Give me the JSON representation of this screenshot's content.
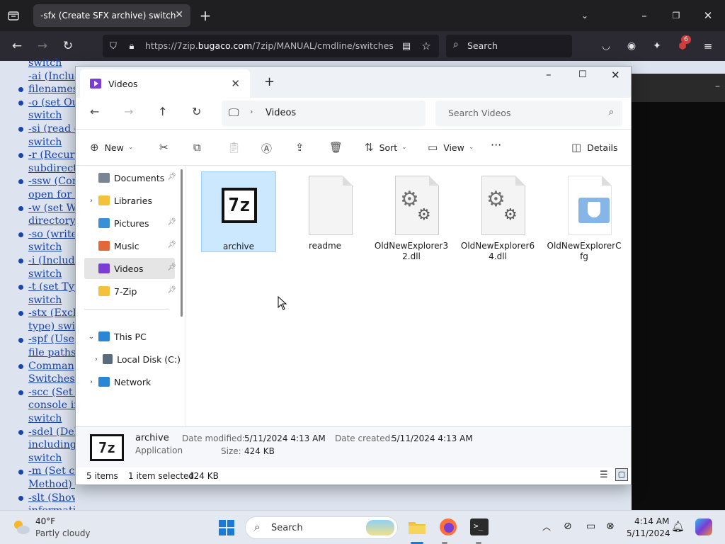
{
  "browser": {
    "tab_title": "-sfx (Create SFX archive) switch",
    "url_prefix": "https://7zip.",
    "url_domain": "bugaco.com",
    "url_path": "/7zip/MANUAL/cmdline/switches",
    "search_placeholder": "Search",
    "extension_badge": "6"
  },
  "webpage": {
    "links": [
      "switch",
      "-ai (Include",
      "filenames",
      "-o (set Ou",
      "switch",
      "-si (read d",
      "switch",
      "-r (Recurs",
      "subdirecto",
      "-ssw (Com",
      "open for w",
      "-w (set W",
      "directory)",
      "-so (write",
      "switch",
      "-i (Include",
      "switch",
      "-t (set Typ",
      "switch",
      "-stx (Excl",
      "type) swit",
      "-spf (Use",
      "file paths)",
      "Comman",
      "Switches",
      "-scc (Set c",
      "console in",
      "switch",
      "-sdel (Del",
      "including",
      "switch",
      "-m (Set co",
      "Method) s",
      "-slt (Show",
      "informati"
    ],
    "bullet_rows": [
      2,
      3,
      5,
      7,
      9,
      11,
      13,
      15,
      17,
      19,
      21,
      23,
      25,
      28,
      31,
      33
    ]
  },
  "explorer": {
    "title": "Videos",
    "breadcrumb": "Videos",
    "search_placeholder": "Search Videos",
    "commands": {
      "new": "New",
      "sort": "Sort",
      "view": "View",
      "more": "···",
      "details": "Details"
    },
    "nav_items": [
      {
        "label": "Documents",
        "icon": "documents-icon",
        "color": "#7a8594",
        "pinned": true,
        "expandable": false
      },
      {
        "label": "Libraries",
        "icon": "folder-icon",
        "color": "#f2c23a",
        "pinned": false,
        "expandable": true
      },
      {
        "label": "Pictures",
        "icon": "pictures-icon",
        "color": "#3a8fd8",
        "pinned": true,
        "expandable": false
      },
      {
        "label": "Music",
        "icon": "music-icon",
        "color": "#e2683c",
        "pinned": true,
        "expandable": false
      },
      {
        "label": "Videos",
        "icon": "videos-icon",
        "color": "#7a3ed6",
        "pinned": true,
        "expandable": false,
        "selected": true
      },
      {
        "label": "7-Zip",
        "icon": "folder-icon",
        "color": "#f2c23a",
        "pinned": true,
        "expandable": false
      }
    ],
    "tree_items": [
      {
        "label": "This PC",
        "icon": "this-pc-icon",
        "color": "#2b87d6",
        "expanded": true
      },
      {
        "label": "Local Disk (C:)",
        "icon": "local-disk-icon",
        "color": "#5a6b7d",
        "expanded": false
      },
      {
        "label": "Network",
        "icon": "network-icon",
        "color": "#2b87d6",
        "expanded": false
      }
    ],
    "files": [
      {
        "name": "archive",
        "type": "7z",
        "selected": true
      },
      {
        "name": "readme",
        "type": "text"
      },
      {
        "name": "OldNewExplorer32.dll",
        "type": "dll"
      },
      {
        "name": "OldNewExplorer64.dll",
        "type": "dll"
      },
      {
        "name": "OldNewExplorerCfg",
        "type": "shield"
      }
    ],
    "details": {
      "name": "archive",
      "kind": "Application",
      "date_modified_label": "Date modified:",
      "date_modified": "5/11/2024 4:13 AM",
      "size_label": "Size:",
      "size": "424 KB",
      "date_created_label": "Date created:",
      "date_created": "5/11/2024 4:13 AM"
    },
    "status": {
      "items": "5 items",
      "selected": "1 item selected",
      "selected_size": "424 KB"
    }
  },
  "taskbar": {
    "weather_temp": "40°F",
    "weather_desc": "Partly cloudy",
    "search_placeholder": "Search",
    "time": "4:14 AM",
    "date": "5/11/2024"
  }
}
